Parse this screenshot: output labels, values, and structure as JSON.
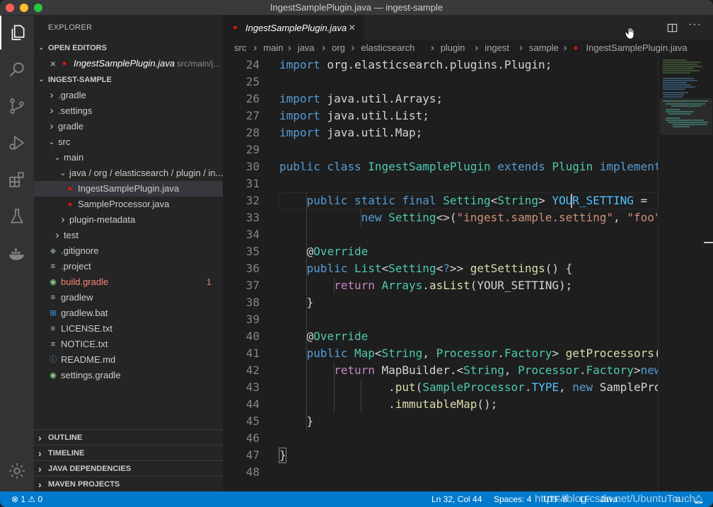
{
  "window": {
    "title": "IngestSamplePlugin.java — ingest-sample"
  },
  "activity_bar": [
    {
      "name": "explorer-icon"
    },
    {
      "name": "search-icon"
    },
    {
      "name": "source-control-icon"
    },
    {
      "name": "run-debug-icon"
    },
    {
      "name": "extensions-icon"
    },
    {
      "name": "testing-icon"
    },
    {
      "name": "docker-icon"
    },
    {
      "name": "settings-gear-icon"
    }
  ],
  "sidebar": {
    "title": "EXPLORER",
    "open_editors": {
      "label": "OPEN EDITORS",
      "items": [
        {
          "name": "IngestSamplePlugin.java",
          "path": "src/main/j..."
        }
      ]
    },
    "project": {
      "label": "INGEST-SAMPLE",
      "tree": [
        {
          "label": ".gradle",
          "kind": "folder",
          "level": 1,
          "open": false
        },
        {
          "label": ".settings",
          "kind": "folder",
          "level": 1,
          "open": false
        },
        {
          "label": "gradle",
          "kind": "folder",
          "level": 1,
          "open": false
        },
        {
          "label": "src",
          "kind": "folder",
          "level": 1,
          "open": true
        },
        {
          "label": "main",
          "kind": "folder",
          "level": 2,
          "open": true
        },
        {
          "label": "java / org / elasticsearch / plugin / in...",
          "kind": "folder",
          "level": 3,
          "open": true
        },
        {
          "label": "IngestSamplePlugin.java",
          "kind": "java",
          "level": 4,
          "selected": true
        },
        {
          "label": "SampleProcessor.java",
          "kind": "java",
          "level": 4
        },
        {
          "label": "plugin-metadata",
          "kind": "folder",
          "level": 3,
          "open": false
        },
        {
          "label": "test",
          "kind": "folder",
          "level": 2,
          "open": false
        },
        {
          "label": ".gitignore",
          "kind": "git",
          "level": 1
        },
        {
          "label": ".project",
          "kind": "text",
          "level": 1
        },
        {
          "label": "build.gradle",
          "kind": "gradle",
          "level": 1,
          "badge": "1",
          "error": true
        },
        {
          "label": "gradlew",
          "kind": "text",
          "level": 1
        },
        {
          "label": "gradlew.bat",
          "kind": "windows",
          "level": 1
        },
        {
          "label": "LICENSE.txt",
          "kind": "text",
          "level": 1
        },
        {
          "label": "NOTICE.txt",
          "kind": "text",
          "level": 1
        },
        {
          "label": "README.md",
          "kind": "info",
          "level": 1
        },
        {
          "label": "settings.gradle",
          "kind": "gradle",
          "level": 1
        }
      ]
    },
    "sections": [
      "OUTLINE",
      "TIMELINE",
      "JAVA DEPENDENCIES",
      "MAVEN PROJECTS"
    ]
  },
  "editor": {
    "tab": {
      "label": "IngestSamplePlugin.java",
      "close": "×"
    },
    "breadcrumb": [
      "src",
      "main",
      "java",
      "org",
      "elasticsearch",
      "plugin",
      "ingest",
      "sample",
      "IngestSamplePlugin.java"
    ],
    "first_line": 24,
    "lines": [
      [
        [
          "kw",
          "import"
        ],
        [
          "p",
          " org.elasticsearch.plugins.Plugin;"
        ]
      ],
      [],
      [
        [
          "kw",
          "import"
        ],
        [
          "p",
          " java.util.Arrays;"
        ]
      ],
      [
        [
          "kw",
          "import"
        ],
        [
          "p",
          " java.util.List;"
        ]
      ],
      [
        [
          "kw",
          "import"
        ],
        [
          "p",
          " java.util.Map;"
        ]
      ],
      [],
      [
        [
          "kw",
          "public class "
        ],
        [
          "ty",
          "IngestSamplePlugin "
        ],
        [
          "kw",
          "extends "
        ],
        [
          "ty",
          "Plugin "
        ],
        [
          "kw",
          "implements"
        ]
      ],
      [],
      [
        [
          "p",
          "    "
        ],
        [
          "kw",
          "public static final "
        ],
        [
          "ty",
          "Setting"
        ],
        [
          "p",
          "<"
        ],
        [
          "ty",
          "String"
        ],
        [
          "p",
          "> "
        ],
        [
          "ct",
          "YOUR_SETTING"
        ],
        [
          "p",
          " ="
        ]
      ],
      [
        [
          "p",
          "            "
        ],
        [
          "kw",
          "new "
        ],
        [
          "ty",
          "Setting"
        ],
        [
          "p",
          "<>("
        ],
        [
          "st",
          "\"ingest.sample.setting\""
        ],
        [
          "p",
          ", "
        ],
        [
          "st",
          "\"foo\""
        ]
      ],
      [],
      [
        [
          "p",
          "    @"
        ],
        [
          "ty",
          "Override"
        ]
      ],
      [
        [
          "p",
          "    "
        ],
        [
          "kw",
          "public "
        ],
        [
          "ty",
          "List"
        ],
        [
          "p",
          "<"
        ],
        [
          "ty",
          "Setting"
        ],
        [
          "p",
          "<"
        ],
        [
          "kw",
          "?"
        ],
        [
          "p",
          ">> "
        ],
        [
          "fn",
          "getSettings"
        ],
        [
          "p",
          "() {"
        ]
      ],
      [
        [
          "p",
          "        "
        ],
        [
          "kp",
          "return "
        ],
        [
          "ty",
          "Arrays"
        ],
        [
          "p",
          "."
        ],
        [
          "fn",
          "asList"
        ],
        [
          "p",
          "(YOUR_SETTING);"
        ]
      ],
      [
        [
          "p",
          "    }"
        ]
      ],
      [],
      [
        [
          "p",
          "    @"
        ],
        [
          "ty",
          "Override"
        ]
      ],
      [
        [
          "p",
          "    "
        ],
        [
          "kw",
          "public "
        ],
        [
          "ty",
          "Map"
        ],
        [
          "p",
          "<"
        ],
        [
          "ty",
          "String"
        ],
        [
          "p",
          ", "
        ],
        [
          "ty",
          "Processor"
        ],
        [
          "p",
          "."
        ],
        [
          "ty",
          "Factory"
        ],
        [
          "p",
          "> "
        ],
        [
          "fn",
          "getProcessors"
        ],
        [
          "p",
          "("
        ]
      ],
      [
        [
          "p",
          "        "
        ],
        [
          "kp",
          "return "
        ],
        [
          "p",
          "MapBuilder.<"
        ],
        [
          "ty",
          "String"
        ],
        [
          "p",
          ", "
        ],
        [
          "ty",
          "Processor"
        ],
        [
          "p",
          "."
        ],
        [
          "ty",
          "Factory"
        ],
        [
          "p",
          ">"
        ],
        [
          "kw",
          "new"
        ]
      ],
      [
        [
          "p",
          "                ."
        ],
        [
          "fn",
          "put"
        ],
        [
          "p",
          "("
        ],
        [
          "ty",
          "SampleProcessor"
        ],
        [
          "p",
          "."
        ],
        [
          "ct",
          "TYPE"
        ],
        [
          "p",
          ", "
        ],
        [
          "kw",
          "new "
        ],
        [
          "p",
          "SamplePro"
        ]
      ],
      [
        [
          "p",
          "                ."
        ],
        [
          "fn",
          "immutableMap"
        ],
        [
          "p",
          "();"
        ]
      ],
      [
        [
          "p",
          "    }"
        ]
      ],
      [],
      [
        [
          "p",
          "}"
        ]
      ],
      []
    ]
  },
  "status_bar": {
    "problems": "⊗ 1  ⚠ 0",
    "cursor": "Ln 32, Col 44",
    "spaces": "Spaces: 4",
    "encoding": "UTF-8",
    "eol": "LF",
    "language": "Java"
  },
  "watermark": "https://blog.csdn.net/UbuntuTouch",
  "colors": {
    "accent": "#007acc",
    "error": "#f48771",
    "java": "#e51400"
  }
}
